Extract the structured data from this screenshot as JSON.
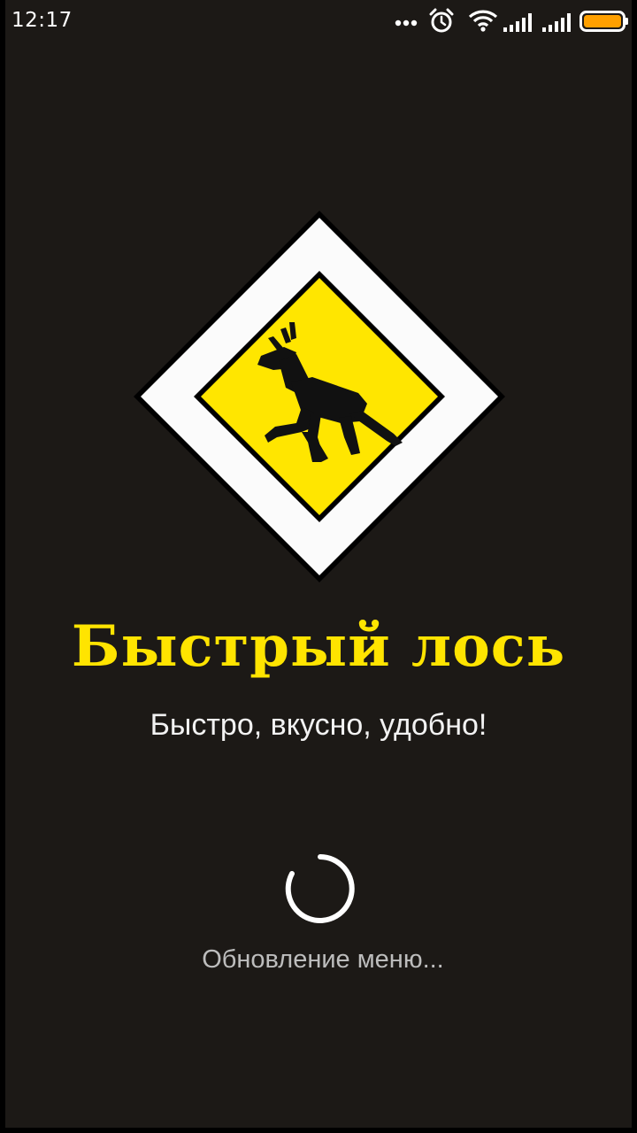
{
  "status_bar": {
    "time": "12:17",
    "icons": [
      "more-dots-icon",
      "alarm-icon",
      "wifi-icon",
      "signal-icon",
      "signal-icon",
      "battery-icon"
    ],
    "battery_color": "#ffa000"
  },
  "splash": {
    "logo": "moose-crossing-road-sign",
    "title": "Быстрый лось",
    "slogan": "Быстро, вкусно, удобно!",
    "loading_text": "Обновление меню...",
    "accent_color": "#ffe400",
    "background_color": "#1c1916"
  }
}
